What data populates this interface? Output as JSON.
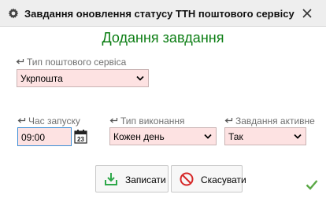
{
  "window": {
    "title": "Завдання оновлення статусу ТТН поштового сервісу"
  },
  "form": {
    "heading": "Додання завдання",
    "postal_service": {
      "label": "Тип поштового сервіса",
      "value": "Укрпошта"
    },
    "start_time": {
      "label": "Час запуску",
      "value": "09:00"
    },
    "execution_type": {
      "label": "Тип виконання",
      "value": "Кожен день"
    },
    "task_active": {
      "label": "Завдання активне",
      "value": "Так"
    }
  },
  "buttons": {
    "save": "Записати",
    "cancel": "Скасувати"
  },
  "colors": {
    "heading": "#0a7d12",
    "field_bg": "#fde2e2",
    "save_icon": "#2ea84a",
    "cancel_icon": "#d62828"
  }
}
